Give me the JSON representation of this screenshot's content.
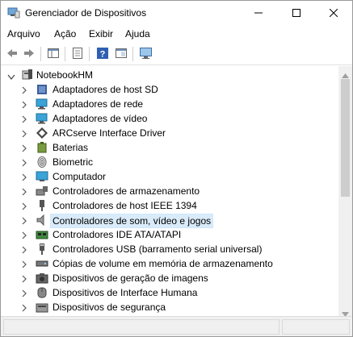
{
  "window": {
    "title": "Gerenciador de Dispositivos",
    "controls": [
      "minimize",
      "maximize",
      "close"
    ]
  },
  "menu": {
    "items": [
      {
        "label": "Arquivo"
      },
      {
        "label": "Ação"
      },
      {
        "label": "Exibir"
      },
      {
        "label": "Ajuda"
      }
    ]
  },
  "toolbar": {
    "buttons": [
      "back-icon",
      "forward-icon",
      "properties-view-icon",
      "device-view-icon",
      "help-icon",
      "details-view-icon",
      "monitor-scan-icon"
    ]
  },
  "tree": {
    "root": {
      "label": "NotebookHM",
      "expanded": true
    },
    "items": [
      {
        "label": "Adaptadores de host SD",
        "icon": "sd-host-icon"
      },
      {
        "label": "Adaptadores de rede",
        "icon": "network-icon"
      },
      {
        "label": "Adaptadores de vídeo",
        "icon": "display-adapter-icon"
      },
      {
        "label": "ARCserve Interface Driver",
        "icon": "arcserve-icon"
      },
      {
        "label": "Baterias",
        "icon": "battery-icon"
      },
      {
        "label": "Biometric",
        "icon": "fingerprint-icon"
      },
      {
        "label": "Computador",
        "icon": "computer-icon"
      },
      {
        "label": "Controladores de armazenamento",
        "icon": "storage-controller-icon"
      },
      {
        "label": "Controladores de host IEEE 1394",
        "icon": "ieee1394-icon"
      },
      {
        "label": "Controladores de som, vídeo e jogos",
        "icon": "speaker-icon",
        "selected": true
      },
      {
        "label": "Controladores IDE ATA/ATAPI",
        "icon": "ide-controller-icon"
      },
      {
        "label": "Controladores USB (barramento serial universal)",
        "icon": "usb-icon"
      },
      {
        "label": "Cópias de volume em memória de armazenamento",
        "icon": "volume-shadow-icon"
      },
      {
        "label": "Dispositivos de geração de imagens",
        "icon": "camera-icon"
      },
      {
        "label": "Dispositivos de Interface Humana",
        "icon": "hid-icon"
      },
      {
        "label": "Dispositivos de segurança",
        "icon": "security-device-icon"
      }
    ]
  },
  "colors": {
    "selection": "#d9ebf9",
    "accent_blue": "#2e7dd7"
  }
}
